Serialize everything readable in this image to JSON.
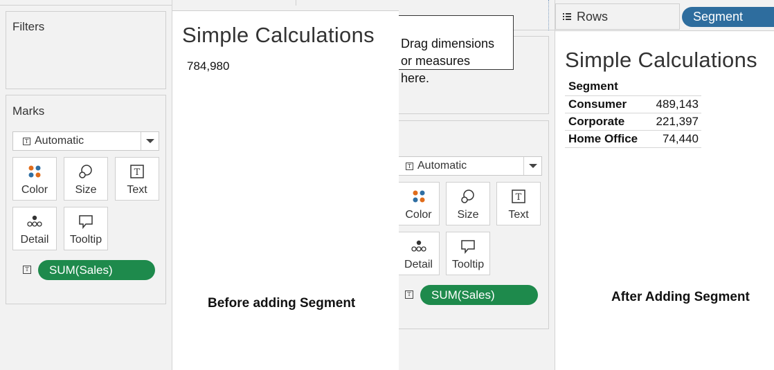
{
  "before": {
    "filters_title": "Filters",
    "marks_title": "Marks",
    "mark_type": "Automatic",
    "buttons": {
      "color": "Color",
      "size": "Size",
      "text": "Text",
      "detail": "Detail",
      "tooltip": "Tooltip"
    },
    "pill": "SUM(Sales)",
    "sheet_title": "Simple Calculations",
    "total_value": "784,980",
    "caption": "Before adding Segment"
  },
  "after": {
    "drop_hint": "Drag dimensions\nor measures\nhere.",
    "rows_label": "Rows",
    "rows_pill": "Segment",
    "mark_type": "Automatic",
    "buttons": {
      "color": "Color",
      "size": "Size",
      "text": "Text",
      "detail": "Detail",
      "tooltip": "Tooltip"
    },
    "pill": "SUM(Sales)",
    "sheet_title": "Simple Calculations",
    "table": {
      "header": "Segment",
      "rows": [
        {
          "label": "Consumer",
          "value": "489,143"
        },
        {
          "label": "Corporate",
          "value": "221,397"
        },
        {
          "label": "Home Office",
          "value": "74,440"
        }
      ]
    },
    "caption": "After Adding Segment"
  },
  "colors": {
    "pill_green": "#1e8a4c",
    "pill_blue": "#2e6d9e",
    "panel_gray": "#f2f2f2"
  }
}
